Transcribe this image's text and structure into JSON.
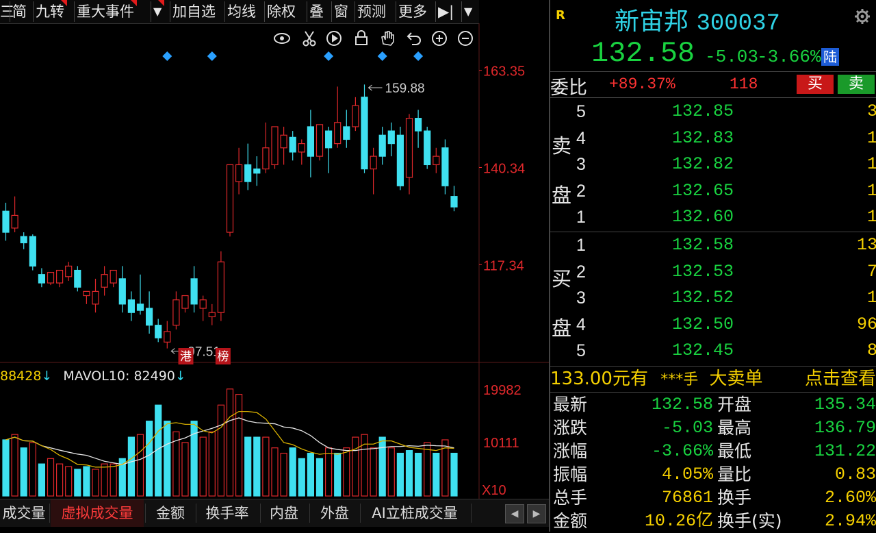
{
  "toolbar": {
    "items": [
      "三",
      "简",
      "九转",
      "重大事件",
      "▼",
      "加自选",
      "均线",
      "除权",
      "叠",
      "窗",
      "预测",
      "更多",
      "▶|",
      "▼"
    ]
  },
  "chart": {
    "y_labels": [
      "163.35",
      "140.34",
      "117.34"
    ],
    "high_label": "159.88",
    "low_label": "97.51",
    "badge_hk": "港",
    "badge_list": "榜",
    "tool_icons": [
      "eye-icon",
      "scissors-icon",
      "play-icon",
      "lock-icon",
      "hand-icon",
      "undo-icon",
      "zoom-in-icon",
      "zoom-out-icon"
    ]
  },
  "volume": {
    "mavol5_text": "88428",
    "mavol10_label": "MAVOL10:",
    "mavol10_value": "82490",
    "y_labels": [
      "19982",
      "10111"
    ],
    "unit": "X10"
  },
  "tabs": [
    "成交量",
    "虚拟成交量",
    "金额",
    "换手率",
    "内盘",
    "外盘",
    "AI立桩成交量"
  ],
  "quote": {
    "r_badge": "R",
    "name": "新宙邦",
    "code": "300037",
    "price": "132.58",
    "change": "-5.03",
    "change_pct": "-3.66%",
    "lu_badge": "陆",
    "weibi_label": "委比",
    "weibi_value": "+89.37%",
    "weicha_value": "118",
    "buy_btn": "买",
    "sell_btn": "卖"
  },
  "orderbook": {
    "sell_label_top": "卖",
    "sell_label_bottom": "盘",
    "buy_label_top": "买",
    "buy_label_bottom": "盘",
    "sell": [
      {
        "level": "5",
        "price": "132.85",
        "vol": "3"
      },
      {
        "level": "4",
        "price": "132.83",
        "vol": "1"
      },
      {
        "level": "3",
        "price": "132.82",
        "vol": "1"
      },
      {
        "level": "2",
        "price": "132.65",
        "vol": "1"
      },
      {
        "level": "1",
        "price": "132.60",
        "vol": "1"
      }
    ],
    "buy": [
      {
        "level": "1",
        "price": "132.58",
        "vol": "13"
      },
      {
        "level": "2",
        "price": "132.53",
        "vol": "7"
      },
      {
        "level": "3",
        "price": "132.52",
        "vol": "1"
      },
      {
        "level": "4",
        "price": "132.50",
        "vol": "96"
      },
      {
        "level": "5",
        "price": "132.45",
        "vol": "8"
      }
    ]
  },
  "bigorder": {
    "price_text": "133.00元有",
    "hands": "***手",
    "type": "大卖单",
    "action": "点击查看"
  },
  "stats": [
    {
      "l": "最新",
      "lv": "132.58",
      "lc": "green",
      "r": "开盘",
      "rv": "135.34",
      "rc": "green"
    },
    {
      "l": "涨跌",
      "lv": "-5.03",
      "lc": "green",
      "r": "最高",
      "rv": "136.79",
      "rc": "green"
    },
    {
      "l": "涨幅",
      "lv": "-3.66%",
      "lc": "green",
      "r": "最低",
      "rv": "131.22",
      "rc": "green"
    },
    {
      "l": "振幅",
      "lv": "4.05%",
      "lc": "yellow",
      "r": "量比",
      "rv": "0.83",
      "rc": "yellow"
    },
    {
      "l": "总手",
      "lv": "76861",
      "lc": "yellow",
      "r": "换手",
      "rv": "2.60%",
      "rc": "yellow"
    },
    {
      "l": "金额",
      "lv": "10.26亿",
      "lc": "yellow",
      "r": "换手(实)",
      "rv": "2.94%",
      "rc": "yellow"
    }
  ],
  "colors": {
    "up": "#e0282b",
    "down": "#3fe0f0",
    "ma5": "#d8b000",
    "ma10": "#e6e6e6",
    "marker": "#2aa0ff"
  },
  "chart_data": {
    "type": "candlestick",
    "ylim": [
      95,
      168
    ],
    "y_ticks": [
      163.35,
      140.34,
      117.34
    ],
    "high": 159.88,
    "low": 97.51,
    "candles": [
      {
        "o": 130.0,
        "h": 132.0,
        "c": 125.0,
        "l": 123.0
      },
      {
        "o": 126.0,
        "h": 133.5,
        "c": 129.0,
        "l": 125.0
      },
      {
        "o": 124.0,
        "h": 125.0,
        "c": 122.5,
        "l": 121.0
      },
      {
        "o": 124.0,
        "h": 124.5,
        "c": 117.0,
        "l": 116.0
      },
      {
        "o": 115.0,
        "h": 116.5,
        "c": 113.0,
        "l": 112.0
      },
      {
        "o": 113.0,
        "h": 115.0,
        "c": 115.5,
        "l": 112.5
      },
      {
        "o": 113.0,
        "h": 116.0,
        "c": 116.0,
        "l": 112.0
      },
      {
        "o": 114.5,
        "h": 118.0,
        "c": 117.0,
        "l": 113.5
      },
      {
        "o": 116.0,
        "h": 117.0,
        "c": 112.0,
        "l": 111.0
      },
      {
        "o": 110.0,
        "h": 111.0,
        "c": 111.0,
        "l": 108.0
      },
      {
        "o": 108.0,
        "h": 114.0,
        "c": 111.0,
        "l": 106.0
      },
      {
        "o": 112.0,
        "h": 117.0,
        "c": 115.0,
        "l": 110.0
      },
      {
        "o": 113.0,
        "h": 115.0,
        "c": 116.0,
        "l": 112.0
      },
      {
        "o": 114.0,
        "h": 117.0,
        "c": 108.0,
        "l": 106.0
      },
      {
        "o": 109.0,
        "h": 111.0,
        "c": 106.0,
        "l": 104.0
      },
      {
        "o": 108.0,
        "h": 115.0,
        "c": 106.5,
        "l": 105.5
      },
      {
        "o": 107.0,
        "h": 111.0,
        "c": 103.0,
        "l": 101.0
      },
      {
        "o": 103.0,
        "h": 104.5,
        "c": 100.0,
        "l": 99.0
      },
      {
        "o": 99.0,
        "h": 104.0,
        "c": 101.5,
        "l": 97.5
      },
      {
        "o": 103.0,
        "h": 111.0,
        "c": 109.0,
        "l": 102.0
      },
      {
        "o": 107.0,
        "h": 109.0,
        "c": 110.0,
        "l": 106.0
      },
      {
        "o": 114.0,
        "h": 117.0,
        "c": 108.0,
        "l": 106.0
      },
      {
        "o": 107.0,
        "h": 110.0,
        "c": 109.0,
        "l": 104.0
      },
      {
        "o": 105.0,
        "h": 108.0,
        "c": 106.0,
        "l": 103.0
      },
      {
        "o": 106.0,
        "h": 120.5,
        "c": 118.0,
        "l": 104.0
      },
      {
        "o": 125.0,
        "h": 140.0,
        "c": 141.0,
        "l": 124.0
      },
      {
        "o": 137.0,
        "h": 145.0,
        "c": 141.0,
        "l": 134.0
      },
      {
        "o": 141.0,
        "h": 146.0,
        "c": 137.0,
        "l": 135.0
      },
      {
        "o": 140.0,
        "h": 143.0,
        "c": 139.0,
        "l": 136.0
      },
      {
        "o": 140.0,
        "h": 151.0,
        "c": 145.0,
        "l": 139.0
      },
      {
        "o": 141.0,
        "h": 150.0,
        "c": 150.0,
        "l": 140.0
      },
      {
        "o": 145.0,
        "h": 150.0,
        "c": 148.0,
        "l": 141.0
      },
      {
        "o": 147.5,
        "h": 149.0,
        "c": 144.0,
        "l": 142.0
      },
      {
        "o": 144.0,
        "h": 147.0,
        "c": 146.0,
        "l": 141.0
      },
      {
        "o": 150.0,
        "h": 154.0,
        "c": 143.0,
        "l": 138.0
      },
      {
        "o": 143.0,
        "h": 150.0,
        "c": 150.5,
        "l": 142.0
      },
      {
        "o": 149.0,
        "h": 150.0,
        "c": 145.0,
        "l": 139.0
      },
      {
        "o": 146.0,
        "h": 159.5,
        "c": 151.0,
        "l": 145.0
      },
      {
        "o": 150.0,
        "h": 154.0,
        "c": 147.0,
        "l": 145.0
      },
      {
        "o": 150.0,
        "h": 157.0,
        "c": 155.0,
        "l": 149.0
      },
      {
        "o": 157.0,
        "h": 160.0,
        "c": 140.0,
        "l": 139.0
      },
      {
        "o": 140.0,
        "h": 145.0,
        "c": 143.0,
        "l": 134.0
      },
      {
        "o": 148.0,
        "h": 150.0,
        "c": 143.0,
        "l": 141.0
      },
      {
        "o": 149.0,
        "h": 151.0,
        "c": 146.0,
        "l": 143.0
      },
      {
        "o": 148.0,
        "h": 150.0,
        "c": 136.0,
        "l": 135.0
      },
      {
        "o": 138.0,
        "h": 153.0,
        "c": 152.0,
        "l": 134.0
      },
      {
        "o": 152.0,
        "h": 154.0,
        "c": 149.0,
        "l": 145.0
      },
      {
        "o": 149.0,
        "h": 150.0,
        "c": 141.0,
        "l": 140.0
      },
      {
        "o": 141.0,
        "h": 145.0,
        "c": 143.0,
        "l": 139.0
      },
      {
        "o": 145.0,
        "h": 147.0,
        "c": 136.0,
        "l": 134.0
      },
      {
        "o": 133.5,
        "h": 136.0,
        "c": 131.0,
        "l": 130.0
      }
    ],
    "volumes": [
      {
        "v": 10500,
        "up": false
      },
      {
        "v": 11500,
        "up": true
      },
      {
        "v": 9000,
        "up": false
      },
      {
        "v": 10000,
        "up": true
      },
      {
        "v": 6000,
        "up": false
      },
      {
        "v": 7000,
        "up": true
      },
      {
        "v": 6000,
        "up": true
      },
      {
        "v": 5500,
        "up": true
      },
      {
        "v": 5000,
        "up": false
      },
      {
        "v": 5500,
        "up": false
      },
      {
        "v": 5000,
        "up": true
      },
      {
        "v": 6000,
        "up": true
      },
      {
        "v": 6000,
        "up": true
      },
      {
        "v": 7000,
        "up": false
      },
      {
        "v": 11000,
        "up": false
      },
      {
        "v": 11500,
        "up": true
      },
      {
        "v": 14000,
        "up": false
      },
      {
        "v": 17000,
        "up": false
      },
      {
        "v": 14000,
        "up": false
      },
      {
        "v": 12000,
        "up": true
      },
      {
        "v": 10000,
        "up": true
      },
      {
        "v": 14000,
        "up": false
      },
      {
        "v": 11000,
        "up": true
      },
      {
        "v": 12000,
        "up": true
      },
      {
        "v": 17000,
        "up": true
      },
      {
        "v": 20000,
        "up": true
      },
      {
        "v": 19000,
        "up": true
      },
      {
        "v": 11000,
        "up": false
      },
      {
        "v": 11000,
        "up": false
      },
      {
        "v": 11000,
        "up": true
      },
      {
        "v": 9000,
        "up": true
      },
      {
        "v": 8000,
        "up": true
      },
      {
        "v": 9000,
        "up": false
      },
      {
        "v": 7000,
        "up": false
      },
      {
        "v": 8000,
        "up": false
      },
      {
        "v": 7000,
        "up": false
      },
      {
        "v": 9000,
        "up": true
      },
      {
        "v": 8000,
        "up": false
      },
      {
        "v": 9000,
        "up": true
      },
      {
        "v": 11000,
        "up": true
      },
      {
        "v": 11500,
        "up": true
      },
      {
        "v": 9000,
        "up": true
      },
      {
        "v": 11000,
        "up": false
      },
      {
        "v": 9000,
        "up": true
      },
      {
        "v": 8000,
        "up": false
      },
      {
        "v": 8500,
        "up": false
      },
      {
        "v": 8000,
        "up": false
      },
      {
        "v": 10000,
        "up": true
      },
      {
        "v": 8000,
        "up": false
      },
      {
        "v": 10500,
        "up": true
      },
      {
        "v": 8000,
        "up": false
      }
    ],
    "vol_ylim": [
      0,
      21000
    ],
    "markers_at_candle": [
      18,
      23,
      36,
      42,
      46
    ]
  }
}
